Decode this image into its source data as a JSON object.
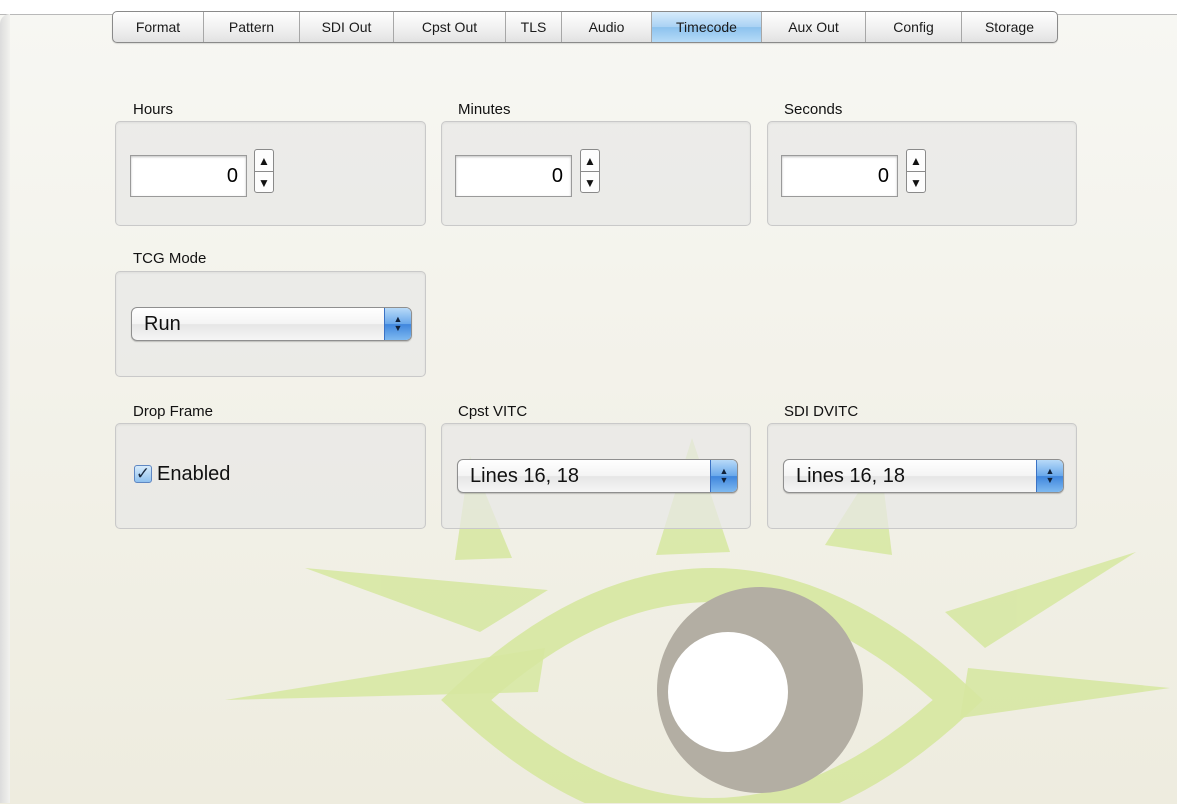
{
  "tabs": [
    {
      "label": "Format",
      "active": false
    },
    {
      "label": "Pattern",
      "active": false
    },
    {
      "label": "SDI Out",
      "active": false
    },
    {
      "label": "Cpst Out",
      "active": false
    },
    {
      "label": "TLS",
      "active": false
    },
    {
      "label": "Audio",
      "active": false
    },
    {
      "label": "Timecode",
      "active": true
    },
    {
      "label": "Aux Out",
      "active": false
    },
    {
      "label": "Config",
      "active": false
    },
    {
      "label": "Storage",
      "active": false
    }
  ],
  "hours": {
    "label": "Hours",
    "value": "0"
  },
  "minutes": {
    "label": "Minutes",
    "value": "0"
  },
  "seconds": {
    "label": "Seconds",
    "value": "0"
  },
  "tcg_mode": {
    "label": "TCG Mode",
    "selected": "Run"
  },
  "drop_frame": {
    "label": "Drop Frame",
    "checkbox_label": "Enabled",
    "checked": true
  },
  "cpst_vitc": {
    "label": "Cpst VITC",
    "selected": "Lines 16, 18"
  },
  "sdi_dvitc": {
    "label": "SDI DVITC",
    "selected": "Lines 16, 18"
  },
  "icons": {
    "stepper_up": "▲",
    "stepper_down": "▼",
    "popup_up": "▲",
    "popup_down": "▼",
    "check": "✓"
  },
  "colors": {
    "active_tab": "#a9d2f4",
    "watermark_green": "#d3e59c",
    "watermark_gray": "#b2ada2",
    "popup_accent": "#4a8ee0"
  }
}
